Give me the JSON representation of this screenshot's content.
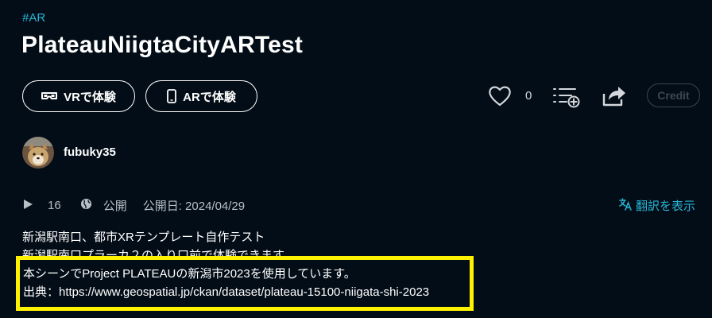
{
  "header": {
    "hashtag": "#AR",
    "title": "PlateauNiigtaCityARTest"
  },
  "actions": {
    "vr_button_label": "VRで体験",
    "ar_button_label": "ARで体験",
    "like_count": "0",
    "credit_label": "Credit"
  },
  "author": {
    "username": "fubuky35"
  },
  "meta": {
    "play_count": "16",
    "visibility": "公開",
    "published_label": "公開日: 2024/04/29",
    "translate_label": "翻訳を表示"
  },
  "description": {
    "line1": "新潟駅南口、都市XRテンプレート自作テスト",
    "line2": "新潟駅南口プラーカ２の入り口前で体験できます",
    "line3": "本シーンでProject PLATEAUの新潟市2023を使用しています。",
    "line4": "出典：https://www.geospatial.jp/ckan/dataset/plateau-15100-niigata-shi-2023"
  },
  "colors": {
    "background": "#030d17",
    "accent": "#27b6d6",
    "highlight_border": "#fff200"
  },
  "icons": [
    "vr-goggles-icon",
    "smartphone-icon",
    "heart-icon",
    "add-to-playlist-icon",
    "share-icon",
    "play-icon",
    "globe-icon",
    "translate-icon"
  ]
}
